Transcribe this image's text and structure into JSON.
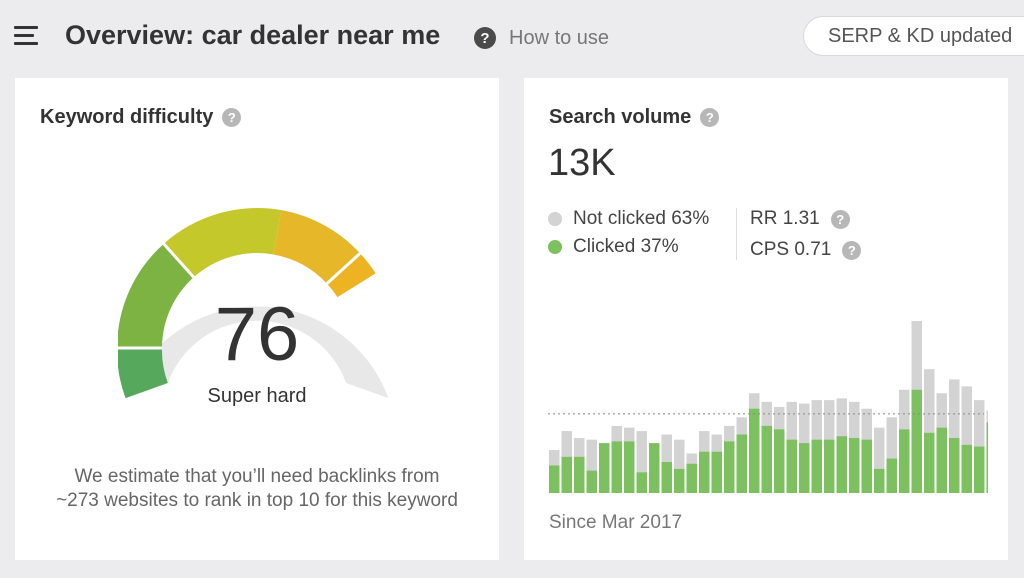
{
  "header": {
    "title": "Overview: car dealer near me",
    "help_icon": "?",
    "howto_label": "How to use",
    "serp_label": "SERP & KD updated"
  },
  "keyword_difficulty": {
    "title": "Keyword difficulty",
    "help_icon": "?",
    "value": "76",
    "label": "Super hard",
    "note_line1": "We estimate that you’ll need backlinks from",
    "note_line2": "~273 websites to rank in top 10 for this keyword",
    "level": 76,
    "colors": {
      "green_dark": "#55a85c",
      "green": "#7cb342",
      "yellow_green": "#c5c82b",
      "yellow": "#e6b829",
      "orange": "#edb323",
      "track": "#e8e8e8"
    }
  },
  "search_volume": {
    "title": "Search volume",
    "help_icon": "?",
    "value": "13K",
    "not_clicked": "Not clicked 63%",
    "clicked": "Clicked 37%",
    "rr": "RR 1.31",
    "cps": "CPS 0.71",
    "since": "Since Mar 2017",
    "colors": {
      "not_clicked": "#d3d3d3",
      "clicked": "#7cc05f"
    }
  },
  "chart_data": {
    "type": "bar",
    "series": [
      {
        "values": [
          25,
          36,
          32,
          31,
          26,
          39,
          38,
          36,
          21,
          34,
          31,
          23,
          36,
          34,
          39,
          44,
          58,
          53,
          50,
          53,
          52,
          54,
          54,
          55,
          53,
          49,
          38,
          44,
          60,
          100,
          72,
          58,
          66,
          62,
          54,
          48,
          84,
          39,
          50,
          57,
          58,
          58
        ]
      },
      {
        "values": [
          16,
          21,
          21,
          13,
          29,
          30,
          30,
          12,
          29,
          18,
          14,
          17,
          24,
          24,
          30,
          34,
          49,
          39,
          37,
          31,
          29,
          31,
          31,
          33,
          32,
          31,
          14,
          20,
          37,
          60,
          35,
          38,
          32,
          28,
          27,
          41,
          35,
          10,
          30,
          26,
          26,
          26
        ]
      }
    ],
    "reference_line": 46,
    "grid": false
  }
}
